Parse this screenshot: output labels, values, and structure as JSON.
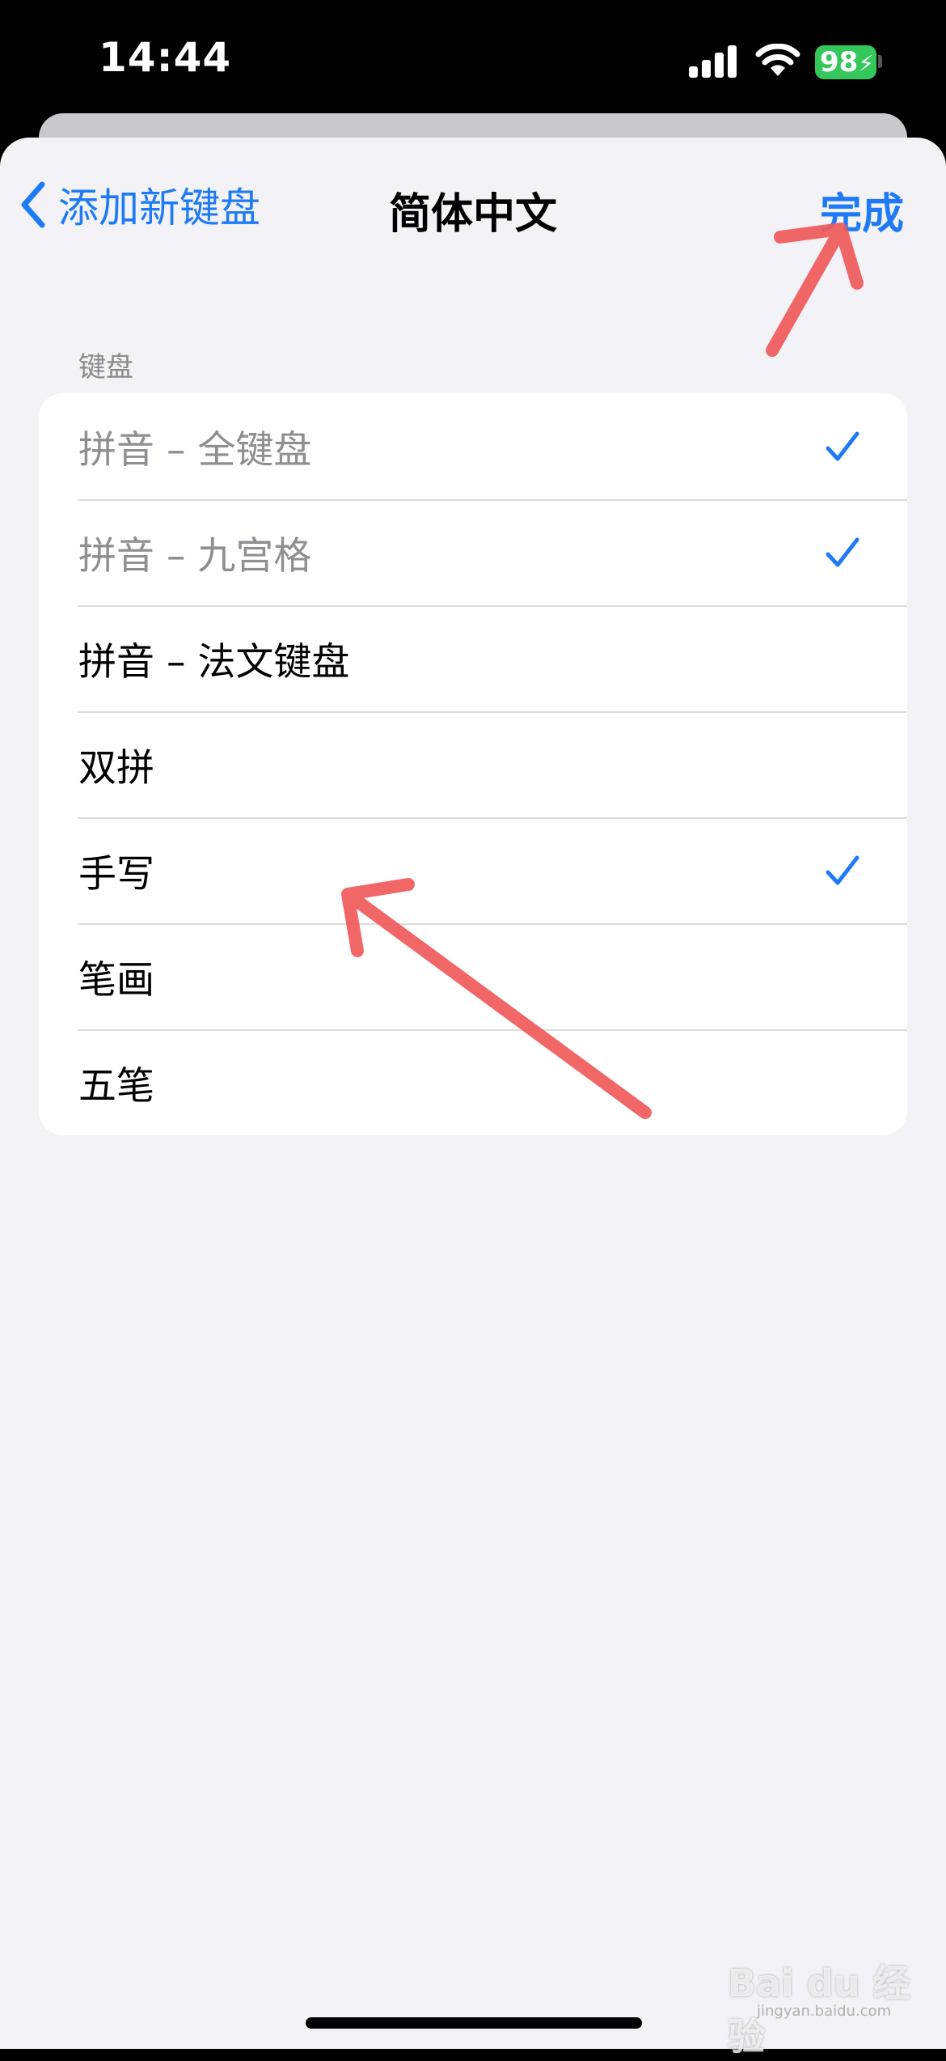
{
  "status_bar": {
    "time": "14:44",
    "battery": "98"
  },
  "nav": {
    "back_label": "添加新键盘",
    "title": "简体中文",
    "done_label": "完成"
  },
  "section": {
    "header": "键盘"
  },
  "keyboards": [
    {
      "label": "拼音 – 全键盘",
      "checked": true,
      "muted": true
    },
    {
      "label": "拼音 – 九宫格",
      "checked": true,
      "muted": true
    },
    {
      "label": "拼音 – 法文键盘",
      "checked": false,
      "muted": false
    },
    {
      "label": "双拼",
      "checked": false,
      "muted": false
    },
    {
      "label": "手写",
      "checked": true,
      "muted": false
    },
    {
      "label": "笔画",
      "checked": false,
      "muted": false
    },
    {
      "label": "五笔",
      "checked": false,
      "muted": false
    }
  ],
  "watermark": {
    "text": "Bai du 经验",
    "sub": "jingyan.baidu.com"
  },
  "colors": {
    "accent": "#1f7bf5",
    "annotation": "#f05a5a",
    "background": "#f2f2f7",
    "battery": "#34c759"
  }
}
